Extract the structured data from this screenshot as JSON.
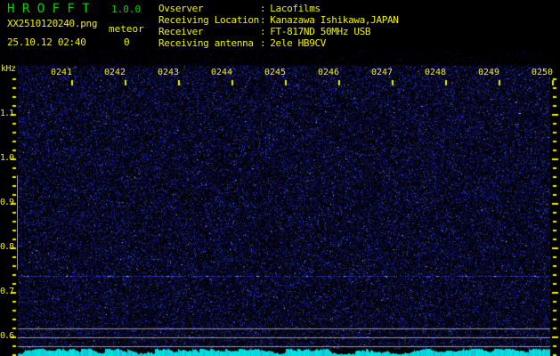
{
  "app": {
    "title": "H R O F F T",
    "version": "1.0.0"
  },
  "capture": {
    "filename": "XX2510120240.png",
    "meteor_label": "meteor",
    "meteor_count": "0",
    "datetime": "25.10.12 02:40"
  },
  "station": {
    "separator": ":",
    "rows": [
      {
        "label": "Ovserver",
        "value": "Lacofilms"
      },
      {
        "label": "Receiving Location",
        "value": "Kanazawa Ishikawa,JAPAN"
      },
      {
        "label": "Receiver",
        "value": "FT-817ND 50MHz USB"
      },
      {
        "label": "Receiving antenna",
        "value": "2ele HB9CV"
      }
    ]
  },
  "spectrogram": {
    "freq_axis": {
      "unit": "kHz",
      "labels": [
        "1.1",
        "1.0",
        "0.9",
        "0.8",
        "0.7",
        "0.6"
      ],
      "tick_step_khz": 0.02
    },
    "time_axis": {
      "labels": [
        "0241",
        "0242",
        "0243",
        "0244",
        "0245",
        "0246",
        "0247",
        "0248",
        "0249",
        "0250"
      ]
    },
    "colors": {
      "label_yellow": "#f0f000",
      "title_green": "#00d400",
      "grid_grey": "#989898",
      "noise_blue": "#1414a0",
      "carrier_blue": "#2232b4",
      "trace_cyan": "#00e0e0"
    }
  }
}
